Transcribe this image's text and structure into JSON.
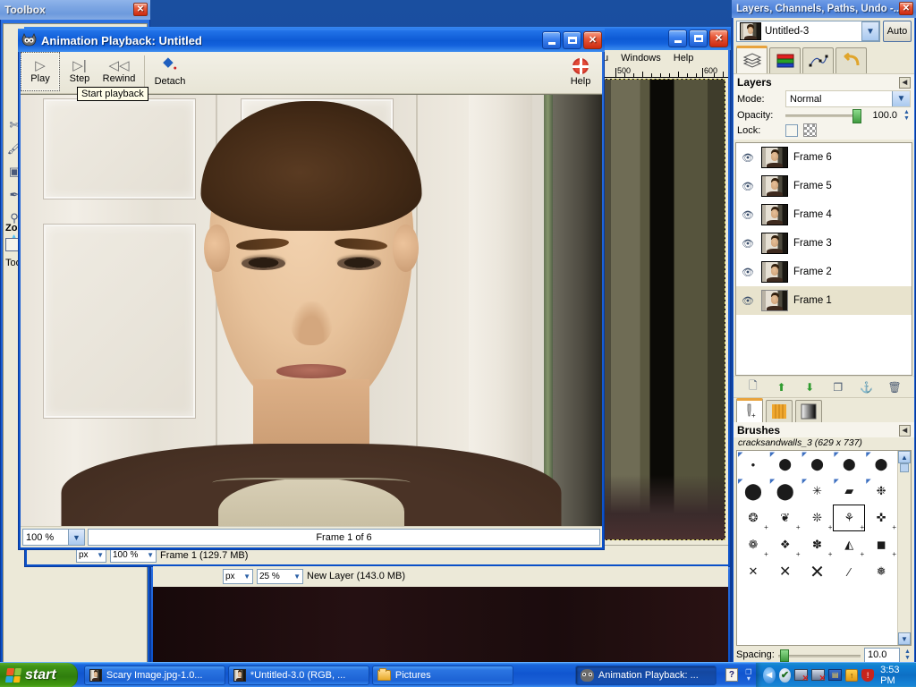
{
  "desktop": {
    "bg_color": "#0d3b8f"
  },
  "toolbox": {
    "title": "Toolbox",
    "close_label": "✕",
    "zoom_section_label": "Zoo",
    "tool_label": "Too",
    "tool_icons": [
      "scissors-icon",
      "paintbrush-icon",
      "bucket-fill-icon",
      "ink-icon",
      "eyedropper-icon",
      "blur-icon"
    ]
  },
  "gimp_window_1": {
    "menus": [
      "u",
      "Windows",
      "Help"
    ],
    "ruler_labels": [
      "500",
      "600"
    ],
    "status": {
      "unit": "px",
      "zoom": "100 %",
      "text": "Frame 1 (129.7 MB)"
    }
  },
  "gimp_window_2": {
    "status": {
      "unit": "px",
      "zoom": "25 %",
      "text": "New Layer (143.0 MB)"
    }
  },
  "animation_window": {
    "title": "Animation Playback: Untitled",
    "icon": "gimp-wilber-icon",
    "window_buttons": {
      "minimize": "_",
      "maximize": "□",
      "close": "✕"
    },
    "toolbar": [
      {
        "label": "Play",
        "icon": "play-icon",
        "pressed": true
      },
      {
        "label": "Step",
        "icon": "step-forward-icon",
        "pressed": false
      },
      {
        "label": "Rewind",
        "icon": "rewind-icon",
        "pressed": false
      },
      {
        "label": "Detach",
        "icon": "detach-icon",
        "pressed": false
      }
    ],
    "help_label": "Help",
    "help_icon": "life-ring-icon",
    "tooltip": "Start playback",
    "zoom_value": "100 %",
    "frame_status": "Frame 1 of 6",
    "canvas_description": "portrait-photo-of-teen-in-front-of-white-door"
  },
  "dock": {
    "title": "Layers, Channels, Paths, Undo -...",
    "close_label": "✕",
    "image_selector": {
      "value": "Untitled-3",
      "auto_label": "Auto",
      "thumb": "image-thumbnail"
    },
    "tabs": [
      {
        "name": "layers-tab",
        "icon": "layers-stack-icon",
        "active": true
      },
      {
        "name": "channels-tab",
        "icon": "channels-icon",
        "active": false
      },
      {
        "name": "paths-tab",
        "icon": "paths-icon",
        "active": false
      },
      {
        "name": "undo-tab",
        "icon": "undo-arrow-icon",
        "active": false
      }
    ],
    "layers_panel": {
      "heading": "Layers",
      "mode_label": "Mode:",
      "mode_value": "Normal",
      "opacity_label": "Opacity:",
      "opacity_value": "100.0",
      "lock_label": "Lock:",
      "layers": [
        {
          "name": "Frame 6",
          "visible": true,
          "selected": false
        },
        {
          "name": "Frame 5",
          "visible": true,
          "selected": false
        },
        {
          "name": "Frame 4",
          "visible": true,
          "selected": false
        },
        {
          "name": "Frame 3",
          "visible": true,
          "selected": false
        },
        {
          "name": "Frame 2",
          "visible": true,
          "selected": false
        },
        {
          "name": "Frame 1",
          "visible": true,
          "selected": true
        }
      ],
      "buttons": [
        {
          "name": "new-layer-button",
          "icon": "new-page-icon"
        },
        {
          "name": "raise-layer-button",
          "icon": "green-up-arrow-icon"
        },
        {
          "name": "lower-layer-button",
          "icon": "green-down-arrow-icon"
        },
        {
          "name": "duplicate-layer-button",
          "icon": "duplicate-icon"
        },
        {
          "name": "anchor-layer-button",
          "icon": "anchor-icon"
        },
        {
          "name": "delete-layer-button",
          "icon": "trash-icon"
        }
      ]
    },
    "brushes_panel": {
      "tabs": [
        {
          "name": "brushes-tab",
          "icon": "brush-icon",
          "active": true
        },
        {
          "name": "patterns-tab",
          "icon": "pattern-icon",
          "active": false
        },
        {
          "name": "gradients-tab",
          "icon": "gradient-icon",
          "active": false
        }
      ],
      "heading": "Brushes",
      "selected_brush": "cracksandwalls_3 (629 x 737)",
      "spacing_label": "Spacing:",
      "spacing_value": "10.0",
      "grid_rows": 5,
      "grid_cols": 5,
      "selected_cell_index": 18
    }
  },
  "taskbar": {
    "start_label": "start",
    "tasks": [
      {
        "label": "Scary Image.jpg-1.0...",
        "icon": "gimp-image-icon",
        "active": false
      },
      {
        "label": "*Untitled-3.0 (RGB, ...",
        "icon": "gimp-image-icon",
        "active": false
      },
      {
        "label": "Pictures",
        "icon": "folder-icon",
        "active": false
      },
      {
        "label": "Animation Playback: ...",
        "icon": "gimp-wilber-icon",
        "active": true
      }
    ],
    "tray": {
      "icons": [
        "help-icon",
        "show-desktop-icon",
        "chevron-left-icon",
        "checkmark-icon",
        "network-disconnected-icon",
        "network-disconnected-icon",
        "security-center-icon",
        "windows-update-icon",
        "antivirus-alert-icon"
      ],
      "clock": "3:53 PM"
    }
  }
}
